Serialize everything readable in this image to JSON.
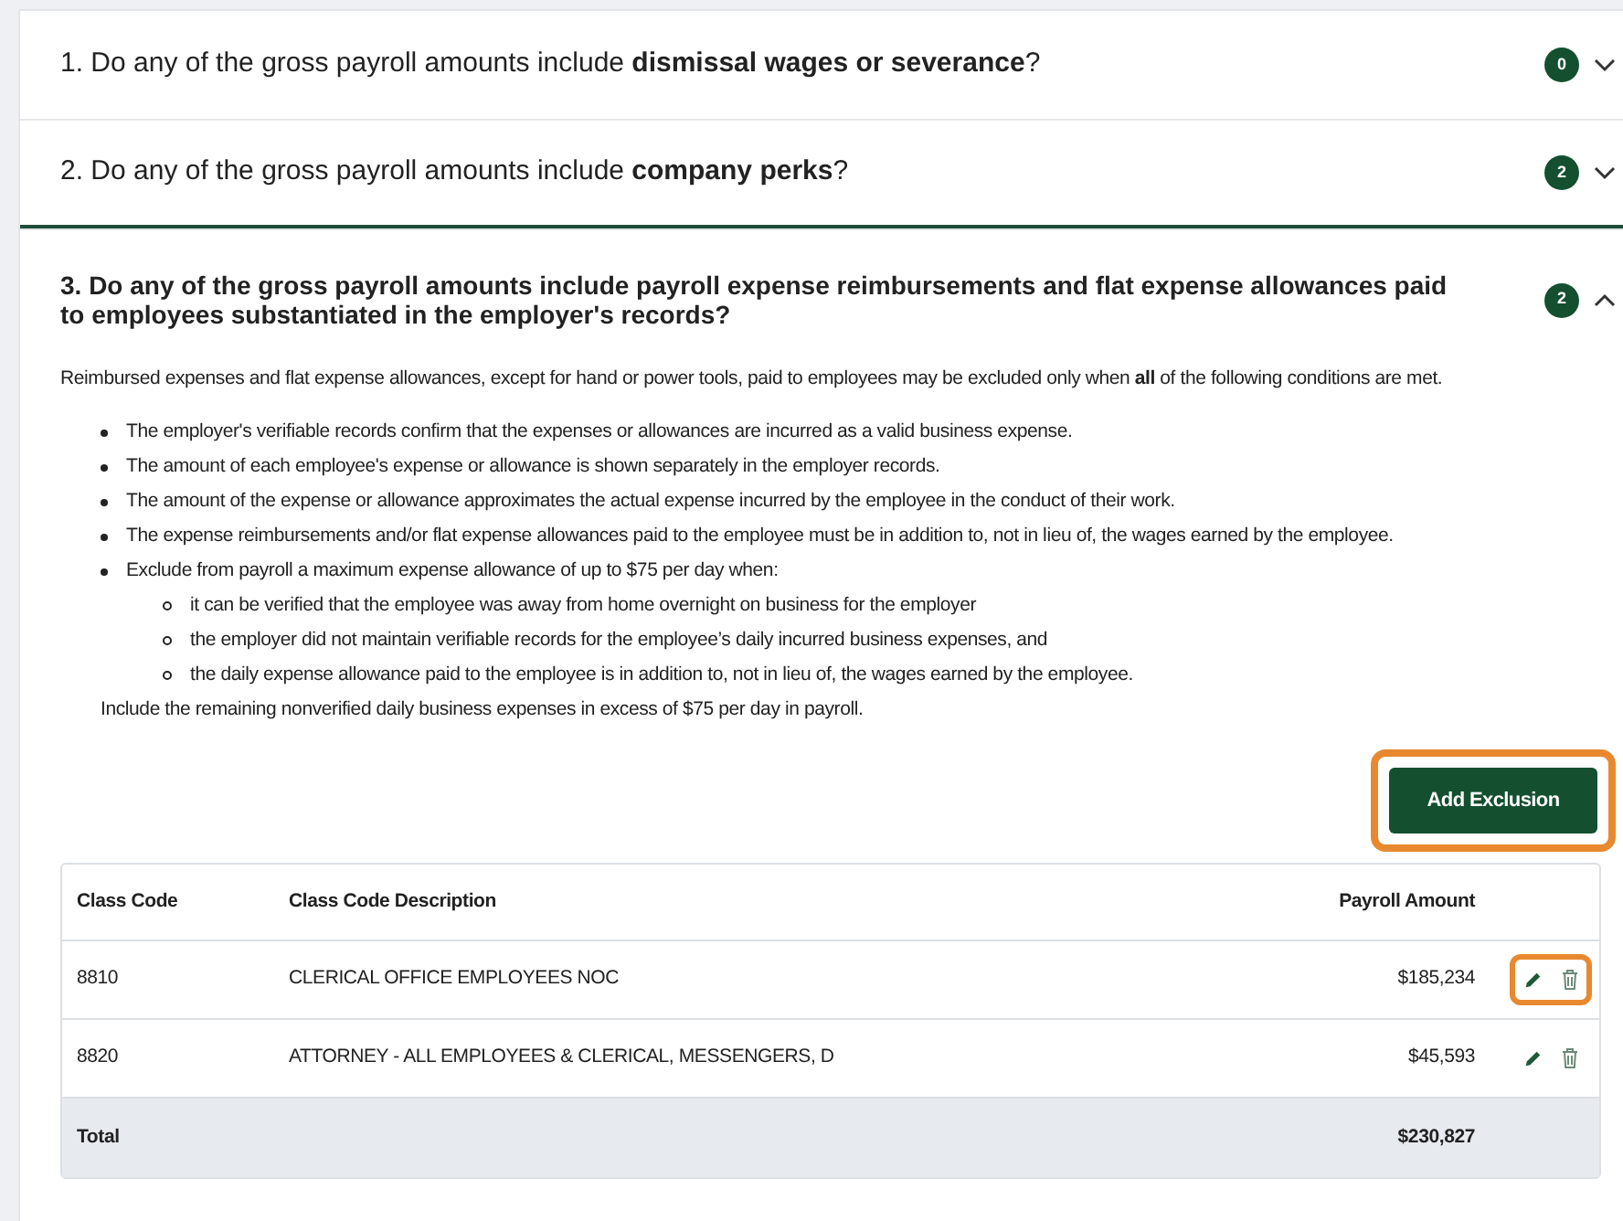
{
  "questions": [
    {
      "title": "1. Do any of the gross payroll amounts include **dismissal wages or severance**?",
      "count": "0",
      "expanded": false
    },
    {
      "title": "2. Do any of the gross payroll amounts include **company perks**?",
      "count": "2",
      "expanded": false
    },
    {
      "title": "3. Do any of the gross payroll amounts include payroll expense reimbursements and flat expense allowances paid to employees substantiated in the employer's records?",
      "count": "2",
      "expanded": true,
      "intro": "Reimbursed expenses and flat expense allowances, except for hand or power tools, paid to employees may be excluded only when **all** of the following conditions are met.",
      "conditions": [
        {
          "text": "The employer's verifiable records confirm that the expenses or allowances are incurred as a valid business expense."
        },
        {
          "text": "The amount of each employee's expense or allowance is shown separately in the employer records."
        },
        {
          "text": "The amount of the expense or allowance approximates the actual expense incurred by the employee in the conduct of their work."
        },
        {
          "text": "The expense reimbursements and/or flat expense allowances paid to the employee must be in addition to, not in lieu of, the wages earned by the employee."
        },
        {
          "text": "Exclude from payroll a maximum expense allowance of up to $75 per day when:",
          "children": [
            {
              "text": "it can be verified that the employee was away from home overnight on business for the employer"
            },
            {
              "text": "the employer did not maintain verifiable records for the employee’s daily incurred business expenses, and"
            },
            {
              "text": "the daily expense allowance paid to the employee is in addition to, not in lieu of, the wages earned by the employee."
            }
          ]
        }
      ],
      "note": "Include the remaining nonverified daily business expenses in excess of $75 per day in payroll.",
      "add_button": {
        "label": "Add Exclusion",
        "highlighted": true
      },
      "table": {
        "columns": [
          "Class Code",
          "Class Code Description",
          "Payroll Amount"
        ],
        "rows": [
          {
            "cells": [
              "8810",
              "CLERICAL OFFICE EMPLOYEES NOC",
              "$185,234"
            ],
            "highlighted": true
          },
          {
            "cells": [
              "8820",
              "ATTORNEY - ALL EMPLOYEES & CLERICAL, MESSENGERS, D",
              "$45,593"
            ],
            "highlighted": false
          }
        ],
        "total": {
          "label": "Total",
          "amount": "$230,827"
        }
      }
    }
  ]
}
